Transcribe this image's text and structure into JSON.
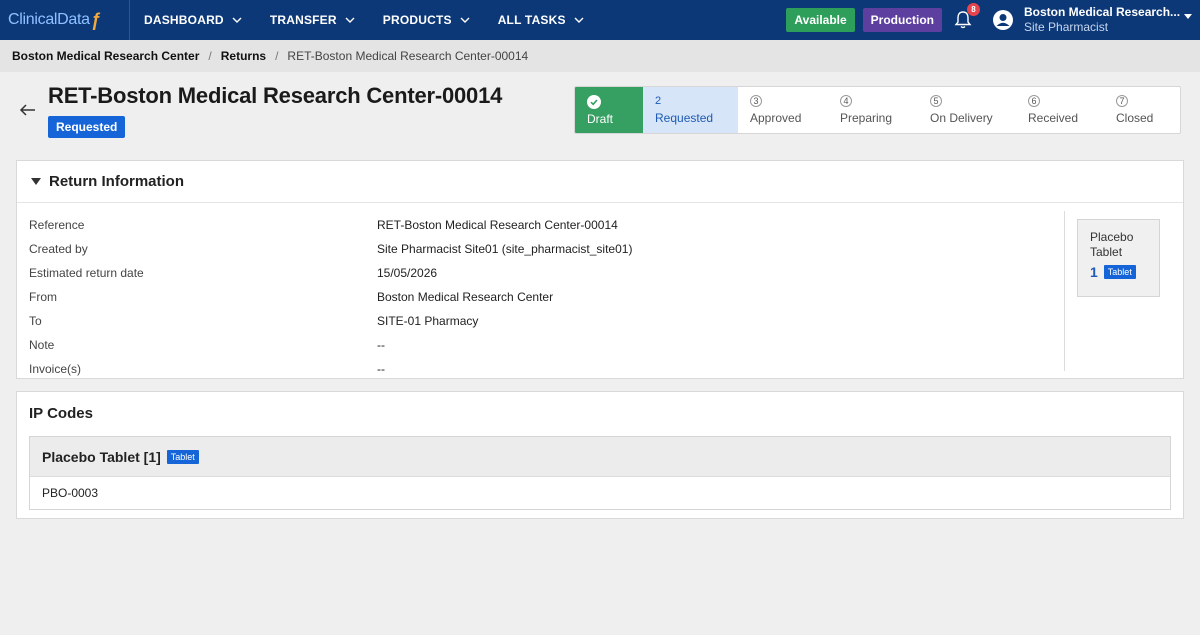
{
  "topbar": {
    "logo_text": "ClinicalData",
    "logo_mark": "ƒ",
    "nav": [
      {
        "label": "DASHBOARD"
      },
      {
        "label": "TRANSFER"
      },
      {
        "label": "PRODUCTS"
      },
      {
        "label": "ALL TASKS"
      }
    ],
    "status_available": "Available",
    "status_environment": "Production",
    "notification_count": "8",
    "user_name": "Boston Medical Research...",
    "user_role": "Site Pharmacist",
    "colors": {
      "bar": "#0c3878",
      "available": "#2e9e5b",
      "production": "#5d3fa0",
      "badge": "#e6454d"
    }
  },
  "breadcrumb": {
    "items": [
      "Boston Medical Research Center",
      "Returns",
      "RET-Boston Medical Research Center-00014"
    ],
    "separator": "/"
  },
  "header": {
    "title": "RET-Boston Medical Research Center-00014",
    "status": "Requested",
    "status_color": "#1565d8"
  },
  "stepper": {
    "steps": [
      {
        "num": "",
        "label": "Draft",
        "state": "done"
      },
      {
        "num": "2",
        "label": "Requested",
        "state": "active"
      },
      {
        "num": "3",
        "label": "Approved",
        "state": "pending"
      },
      {
        "num": "4",
        "label": "Preparing",
        "state": "pending"
      },
      {
        "num": "5",
        "label": "On Delivery",
        "state": "pending"
      },
      {
        "num": "6",
        "label": "Received",
        "state": "pending"
      },
      {
        "num": "7",
        "label": "Closed",
        "state": "pending"
      }
    ]
  },
  "return_info": {
    "title": "Return Information",
    "rows": [
      {
        "label": "Reference",
        "value": "RET-Boston Medical Research Center-00014"
      },
      {
        "label": "Created by",
        "value": "Site Pharmacist Site01 (site_pharmacist_site01)"
      },
      {
        "label": "Estimated return date",
        "value": "15/05/2026"
      },
      {
        "label": "From",
        "value": "Boston Medical Research Center"
      },
      {
        "label": "To",
        "value": "SITE-01 Pharmacy"
      },
      {
        "label": "Note",
        "value": "--"
      },
      {
        "label": "Invoice(s)",
        "value": "--"
      }
    ],
    "summary": {
      "name": "Placebo Tablet",
      "count": "1",
      "form": "Tablet"
    }
  },
  "ip_codes": {
    "title": "IP Codes",
    "groups": [
      {
        "title": "Placebo Tablet [1]",
        "form": "Tablet",
        "codes": [
          "PBO-0003"
        ]
      }
    ]
  }
}
